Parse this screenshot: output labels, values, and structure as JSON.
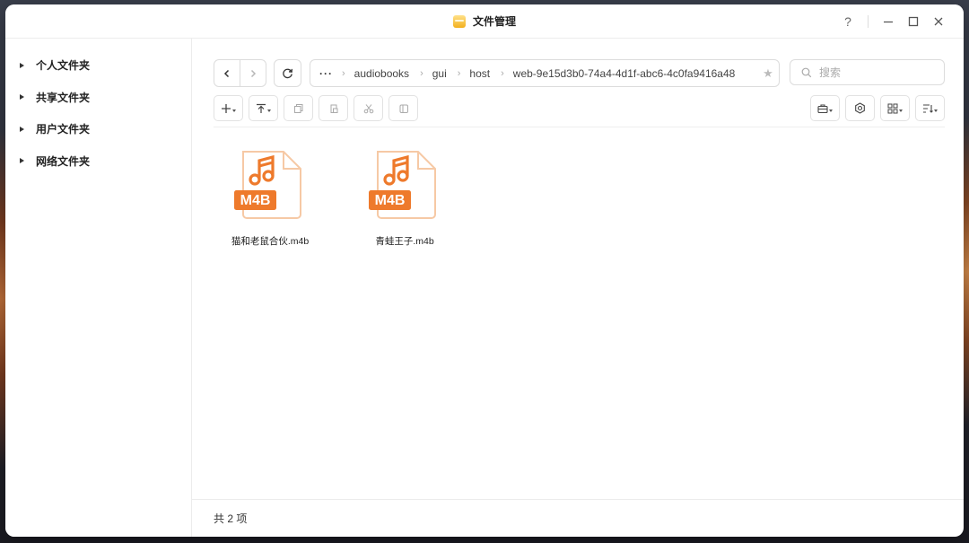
{
  "window": {
    "title": "文件管理"
  },
  "controls": {
    "help": "?"
  },
  "sidebar": {
    "items": [
      {
        "label": "个人文件夹"
      },
      {
        "label": "共享文件夹"
      },
      {
        "label": "用户文件夹"
      },
      {
        "label": "网络文件夹"
      }
    ]
  },
  "path": {
    "more": "···",
    "crumbs": [
      "audiobooks",
      "gui",
      "host"
    ],
    "current": "web-9e15d3b0-74a4-4d1f-abc6-4c0fa9416a48"
  },
  "search": {
    "placeholder": "搜索"
  },
  "files": [
    {
      "name": "猫和老鼠合伙.m4b",
      "badge": "M4B"
    },
    {
      "name": "青蛙王子.m4b",
      "badge": "M4B"
    }
  ],
  "status": {
    "count_text": "共 2 项"
  },
  "colors": {
    "accent": "#ee7a2c",
    "accent_light": "#f6c9a5"
  }
}
